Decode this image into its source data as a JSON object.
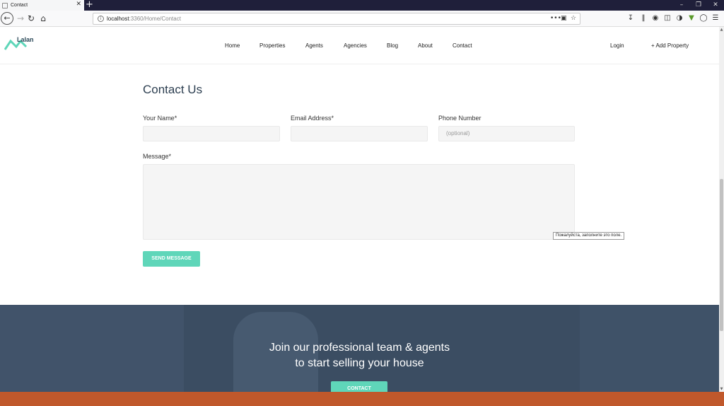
{
  "browser": {
    "tab_title": "Contact",
    "tab_close": "✕",
    "new_tab": "+",
    "url_host": "localhost",
    "url_rest": ":3360/Home/Contact",
    "url_more": "•••"
  },
  "header": {
    "logo_text": "Lalan",
    "nav": [
      "Home",
      "Properties",
      "Agents",
      "Agencies",
      "Blog",
      "About",
      "Contact"
    ],
    "login": "Login",
    "add_property": "+ Add Property"
  },
  "form": {
    "title": "Contact Us",
    "name_label": "Your Name*",
    "email_label": "Email Address*",
    "phone_label": "Phone Number",
    "phone_placeholder": "(optional)",
    "message_label": "Message*",
    "tooltip": "Пожалуйста, заполните это поле.",
    "send_label": "SEND MESSAGE"
  },
  "cta": {
    "line1": "Join our professional team & agents",
    "line2": "to start selling your house",
    "button_label": "CONTACT"
  },
  "colors": {
    "accent": "#5fd6b9",
    "cta_bg": "#3b4d62",
    "taskbar": "#c0582b"
  }
}
